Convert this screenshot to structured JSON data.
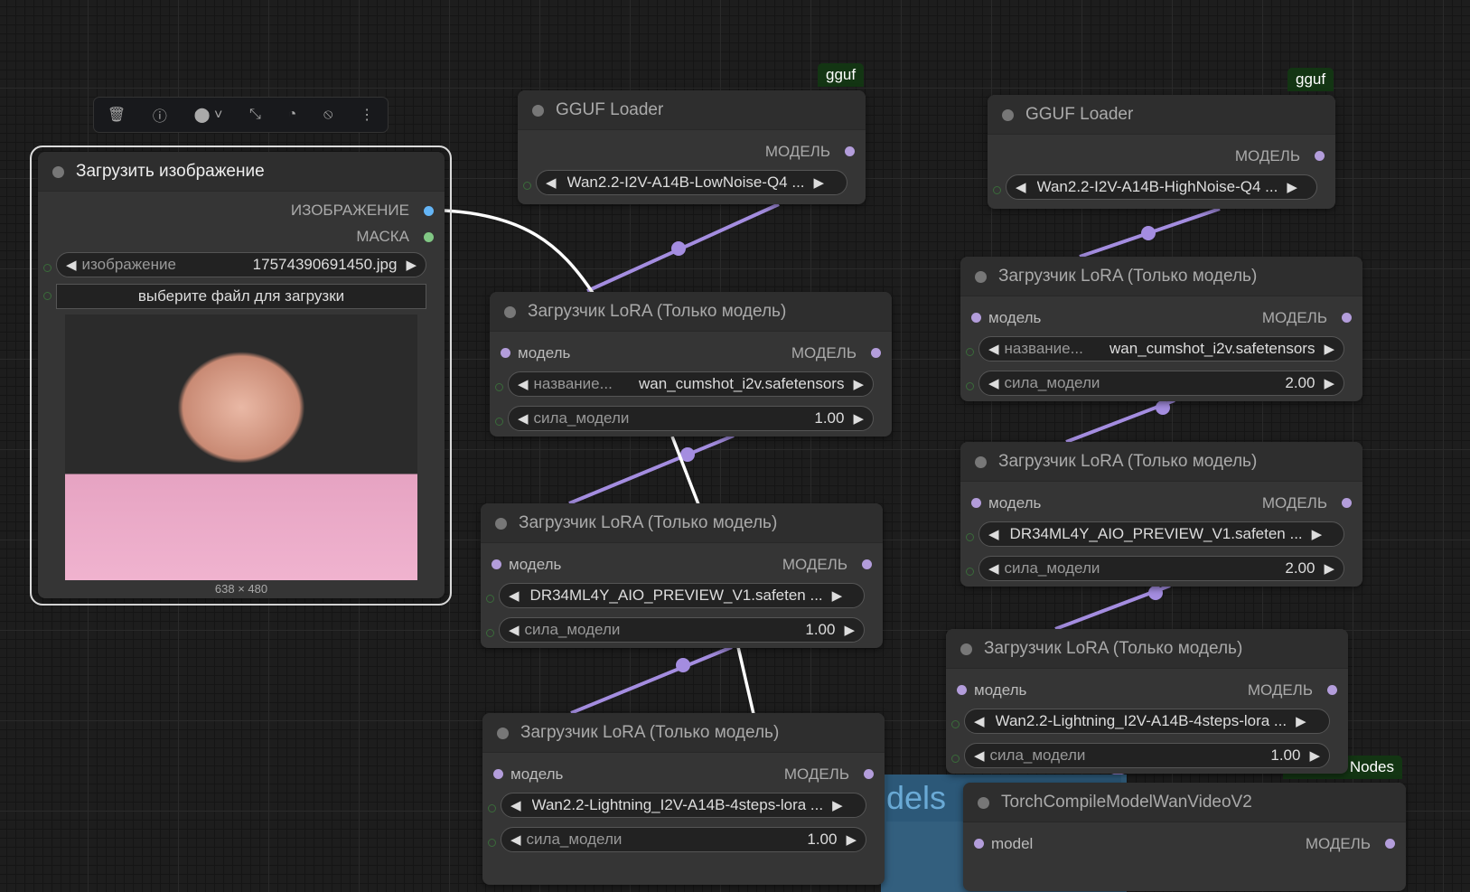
{
  "toolbar": {
    "icons": [
      "trash-icon",
      "info-icon",
      "color-icon",
      "collapse-icon",
      "pin-icon",
      "bypass-icon",
      "more-icon"
    ]
  },
  "badges": {
    "gguf1": "gguf",
    "gguf2": "gguf",
    "nodes": "Nodes"
  },
  "group": {
    "title": "dels"
  },
  "load_image": {
    "title": "Загрузить изображение",
    "outputs": [
      "ИЗОБРАЖЕНИЕ",
      "МАСКА"
    ],
    "image_label": "изображение",
    "image_value": "17574390691450.jpg",
    "upload_button": "выберите файл для загрузки",
    "caption": "638 × 480"
  },
  "nodes": {
    "gguf1": {
      "title": "GGUF Loader",
      "output": "МОДЕЛЬ",
      "widgets": [
        {
          "label": "",
          "value": "Wan2.2-I2V-A14B-LowNoise-Q4 ..."
        }
      ]
    },
    "gguf2": {
      "title": "GGUF Loader",
      "output": "МОДЕЛЬ",
      "widgets": [
        {
          "label": "",
          "value": "Wan2.2-I2V-A14B-HighNoise-Q4 ..."
        }
      ]
    },
    "lora1": {
      "title": "Загрузчик LoRA (Только модель)",
      "input": "модель",
      "output": "МОДЕЛЬ",
      "widgets": [
        {
          "label": "название...",
          "value": "wan_cumshot_i2v.safetensors"
        },
        {
          "label": "сила_модели",
          "value": "1.00"
        }
      ]
    },
    "lora2": {
      "title": "Загрузчик LoRA (Только модель)",
      "input": "модель",
      "output": "МОДЕЛЬ",
      "widgets": [
        {
          "label": "",
          "value": "DR34ML4Y_AIO_PREVIEW_V1.safeten ..."
        },
        {
          "label": "сила_модели",
          "value": "1.00"
        }
      ]
    },
    "lora3": {
      "title": "Загрузчик LoRA (Только модель)",
      "input": "модель",
      "output": "МОДЕЛЬ",
      "widgets": [
        {
          "label": "",
          "value": "Wan2.2-Lightning_I2V-A14B-4steps-lora ..."
        },
        {
          "label": "сила_модели",
          "value": "1.00"
        }
      ]
    },
    "lora4": {
      "title": "Загрузчик LoRA (Только модель)",
      "input": "модель",
      "output": "МОДЕЛЬ",
      "widgets": [
        {
          "label": "название...",
          "value": "wan_cumshot_i2v.safetensors"
        },
        {
          "label": "сила_модели",
          "value": "2.00"
        }
      ]
    },
    "lora5": {
      "title": "Загрузчик LoRA (Только модель)",
      "input": "модель",
      "output": "МОДЕЛЬ",
      "widgets": [
        {
          "label": "",
          "value": "DR34ML4Y_AIO_PREVIEW_V1.safeten ..."
        },
        {
          "label": "сила_модели",
          "value": "2.00"
        }
      ]
    },
    "lora6": {
      "title": "Загрузчик LoRA (Только модель)",
      "input": "модель",
      "output": "МОДЕЛЬ",
      "widgets": [
        {
          "label": "",
          "value": "Wan2.2-Lightning_I2V-A14B-4steps-lora ..."
        },
        {
          "label": "сила_модели",
          "value": "1.00"
        }
      ]
    },
    "torch": {
      "title": "TorchCompileModelWanVideoV2",
      "input": "model",
      "output": "МОДЕЛЬ",
      "widgets": []
    }
  },
  "colors": {
    "model_link": "#a48de0",
    "image_link": "#ffffff",
    "image_slot": "#64b5f6",
    "mask_slot": "#81c784"
  }
}
